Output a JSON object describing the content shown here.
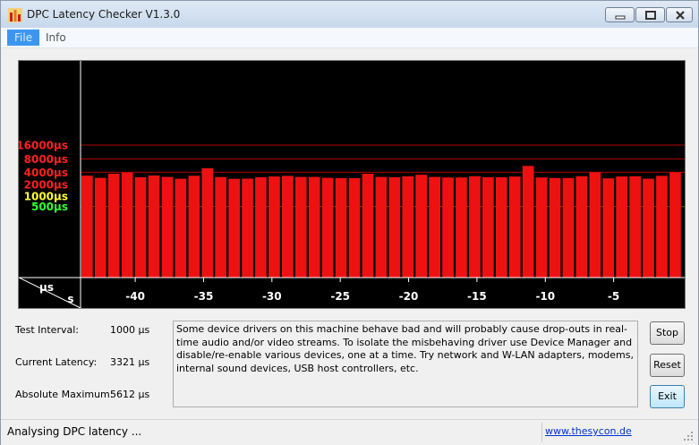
{
  "window": {
    "title": "DPC Latency Checker V1.3.0"
  },
  "menu": {
    "items": [
      "File",
      "Info"
    ]
  },
  "chart_data": {
    "type": "bar",
    "ylabel": "µs",
    "xlabel": "s",
    "y_scale": "log",
    "y_ticks": [
      {
        "label": "16000µs",
        "value": 16000,
        "color": "#ff2020"
      },
      {
        "label": "8000µs",
        "value": 8000,
        "color": "#ff2020"
      },
      {
        "label": "4000µs",
        "value": 4000,
        "color": "#ff2020"
      },
      {
        "label": "2000µs",
        "value": 2000,
        "color": "#ff2020"
      },
      {
        "label": "1000µs",
        "value": 1000,
        "color": "#ffff33"
      },
      {
        "label": "500µs",
        "value": 500,
        "color": "#33ff33"
      }
    ],
    "x_ticks": [
      {
        "label": "-40",
        "value": -40
      },
      {
        "label": "-35",
        "value": -35
      },
      {
        "label": "-30",
        "value": -30
      },
      {
        "label": "-25",
        "value": -25
      },
      {
        "label": "-20",
        "value": -20
      },
      {
        "label": "-15",
        "value": -15
      },
      {
        "label": "-10",
        "value": -10
      },
      {
        "label": "-5",
        "value": -5
      }
    ],
    "x_range": [
      -44,
      0
    ],
    "series": [
      {
        "color": "#ee1111",
        "values": [
          3320,
          2950,
          3700,
          3950,
          3050,
          3350,
          3100,
          2800,
          3300,
          5000,
          3080,
          2780,
          2820,
          3050,
          3180,
          3280,
          3100,
          3100,
          2950,
          2900,
          2900,
          3700,
          3100,
          3050,
          3200,
          3480,
          3100,
          3000,
          3000,
          3220,
          3050,
          3050,
          3150,
          5612,
          3000,
          2920,
          2920,
          3220,
          4000,
          2850,
          3180,
          3200,
          2800,
          3280,
          4000
        ]
      }
    ]
  },
  "stats": {
    "test_interval": {
      "label": "Test Interval:",
      "value": "1000 µs"
    },
    "current_latency": {
      "label": "Current Latency:",
      "value": "3321 µs"
    },
    "absolute_maximum": {
      "label": "Absolute Maximum:",
      "value": "5612 µs"
    }
  },
  "message": "Some device drivers on this machine behave bad and will probably cause drop-outs in real-time audio and/or video streams. To isolate the misbehaving driver use Device Manager and disable/re-enable various devices, one at a time. Try network and W-LAN adapters, modems, internal sound devices, USB host controllers, etc.",
  "buttons": {
    "stop": "Stop",
    "reset": "Reset",
    "exit": "Exit"
  },
  "status": {
    "text": "Analysing DPC latency ...",
    "link": "www.thesycon.de"
  }
}
